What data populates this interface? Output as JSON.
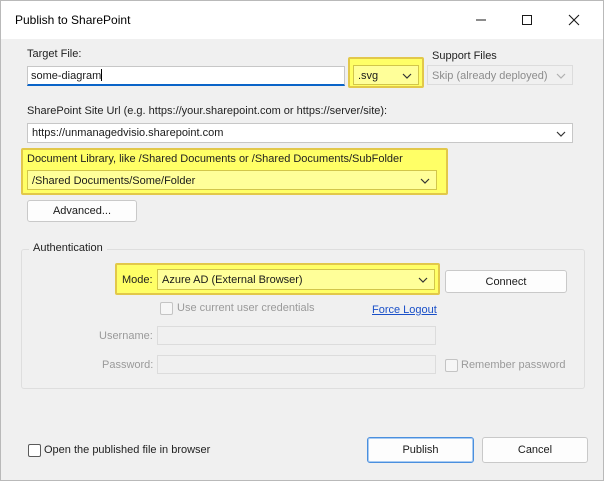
{
  "window": {
    "title": "Publish to SharePoint"
  },
  "target_file": {
    "label": "Target File:",
    "value": "some-diagram",
    "extension": ".svg"
  },
  "support_files": {
    "label": "Support Files",
    "value": "Skip (already deployed)"
  },
  "site_url": {
    "label": "SharePoint Site Url (e.g. https://your.sharepoint.com or https://server/site):",
    "value": "https://unmanagedvisio.sharepoint.com"
  },
  "doc_library": {
    "label": "Document Library, like /Shared Documents or /Shared Documents/SubFolder",
    "value": "/Shared Documents/Some/Folder"
  },
  "advanced_button": "Advanced...",
  "auth": {
    "group_label": "Authentication",
    "mode_label": "Mode:",
    "mode_value": "Azure AD (External Browser)",
    "connect_button": "Connect",
    "use_current_credentials": "Use current user credentials",
    "force_logout": "Force Logout",
    "username_label": "Username:",
    "username_value": "",
    "password_label": "Password:",
    "password_value": "",
    "remember_password": "Remember password"
  },
  "open_in_browser": "Open the published file in browser",
  "publish_button": "Publish",
  "cancel_button": "Cancel",
  "colors": {
    "highlight": "#ffff66",
    "accent": "#0a64c8",
    "link": "#1a50c8"
  }
}
